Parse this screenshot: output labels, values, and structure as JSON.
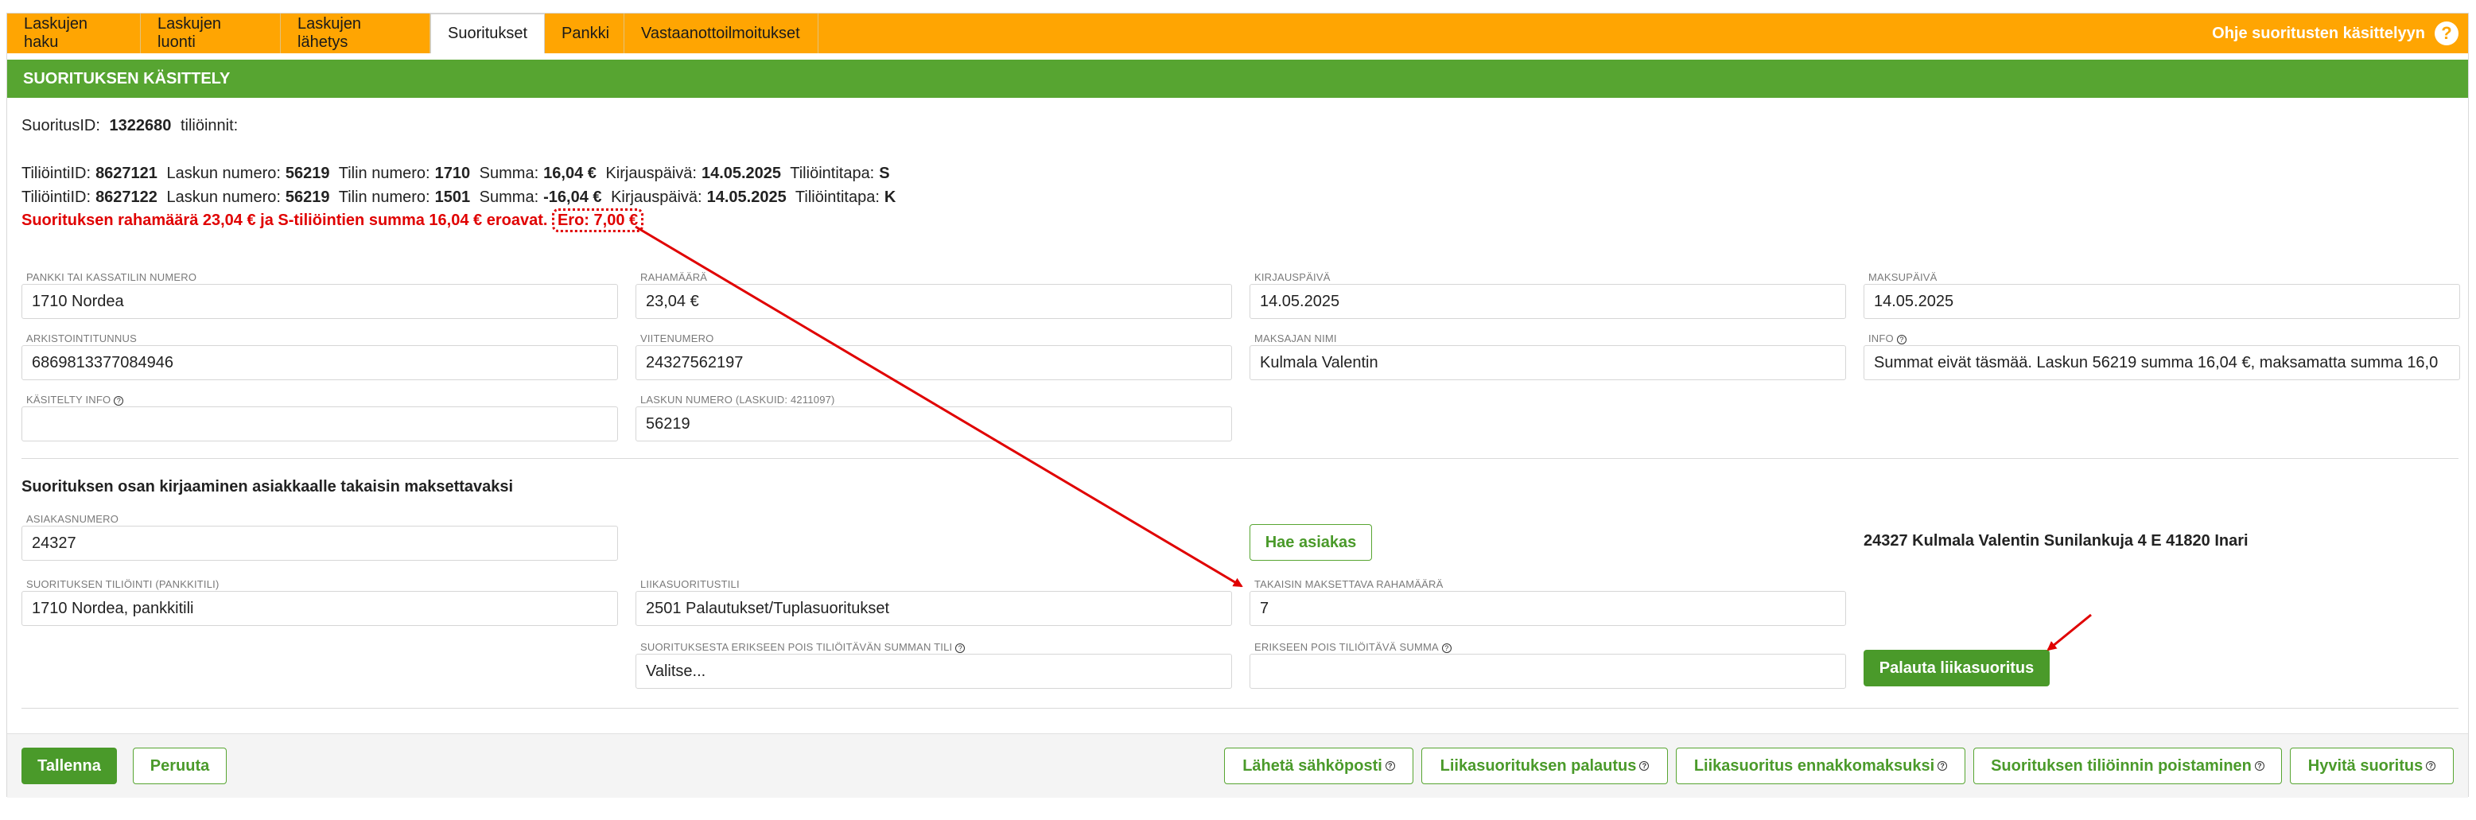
{
  "tabs": [
    {
      "label": "Laskujen haku"
    },
    {
      "label": "Laskujen luonti"
    },
    {
      "label": "Laskujen lähetys"
    },
    {
      "label": "Suoritukset"
    },
    {
      "label": "Pankki"
    },
    {
      "label": "Vastaanottoilmoitukset"
    }
  ],
  "help": {
    "label": "Ohje suoritusten käsittelyyn",
    "icon": "?"
  },
  "section": {
    "title": "SUORITUKSEN KÄSITTELY"
  },
  "summary": {
    "id_label": "SuoritusID:",
    "id_value": "1322680",
    "id_suffix": "tiliöinnit:"
  },
  "postings": [
    {
      "l1": "TiliöintiID:",
      "v1": "8627121",
      "l2": "Laskun numero:",
      "v2": "56219",
      "l3": "Tilin numero:",
      "v3": "1710",
      "l4": "Summa:",
      "v4": "16,04 €",
      "l5": "Kirjauspäivä:",
      "v5": "14.05.2025",
      "l6": "Tiliöintitapa:",
      "v6": "S"
    },
    {
      "l1": "TiliöintiID:",
      "v1": "8627122",
      "l2": "Laskun numero:",
      "v2": "56219",
      "l3": "Tilin numero:",
      "v3": "1501",
      "l4": "Summa:",
      "v4": "-16,04 €",
      "l5": "Kirjauspäivä:",
      "v5": "14.05.2025",
      "l6": "Tiliöintitapa:",
      "v6": "K"
    }
  ],
  "warning": {
    "text": "Suorituksen rahamäärä 23,04 € ja S-tiliöintien summa 16,04 € eroavat.",
    "diff": "Ero: 7,00 €"
  },
  "fields": {
    "bank": {
      "label": "PANKKI TAI KASSATILIN NUMERO",
      "value": "1710 Nordea"
    },
    "amount": {
      "label": "RAHAMÄÄRÄ",
      "value": "23,04 €"
    },
    "booking_date": {
      "label": "KIRJAUSPÄIVÄ",
      "value": "14.05.2025"
    },
    "payment_date": {
      "label": "MAKSUPÄIVÄ",
      "value": "14.05.2025"
    },
    "archive_id": {
      "label": "ARKISTOINTITUNNUS",
      "value": "6869813377084946"
    },
    "reference": {
      "label": "VIITENUMERO",
      "value": "24327562197"
    },
    "payer_name": {
      "label": "MAKSAJAN NIMI",
      "value": "Kulmala Valentin"
    },
    "info": {
      "label": "INFO",
      "value": "Summat eivät täsmää. Laskun 56219 summa 16,04 €, maksamatta summa 16,0"
    },
    "handled_info": {
      "label": "KÄSITELTY INFO",
      "value": ""
    },
    "invoice_number": {
      "label": "LASKUN NUMERO (LASKUID: 4211097)",
      "value": "56219"
    }
  },
  "refund": {
    "title": "Suorituksen osan kirjaaminen asiakkaalle takaisin maksettavaksi",
    "customer_number": {
      "label": "ASIAKASNUMERO",
      "value": "24327"
    },
    "fetch_customer": "Hae asiakas",
    "customer_info": "24327 Kulmala Valentin Sunilankuja 4 E 41820 Inari",
    "payment_account": {
      "label": "SUORITUKSEN TILIÖINTI (PANKKITILI)",
      "value": "1710 Nordea, pankkitili"
    },
    "overpayment_account": {
      "label": "LIIKASUORITUSTILI",
      "value": "2501 Palautukset/Tuplasuoritukset"
    },
    "refund_amount": {
      "label": "TAKAISIN MAKSETTAVA RAHAMÄÄRÄ",
      "value": "7"
    },
    "separate_account": {
      "label": "SUORITUKSESTA ERIKSEEN POIS TILIÖITÄVÄN SUMMAN TILI",
      "value": "Valitse..."
    },
    "separate_amount": {
      "label": "ERIKSEEN POIS TILIÖITÄVÄ SUMMA",
      "value": ""
    },
    "return_button": "Palauta liikasuoritus"
  },
  "footer": {
    "save": "Tallenna",
    "cancel": "Peruuta",
    "send_email": "Lähetä sähköposti",
    "overpayment_return": "Liikasuorituksen palautus",
    "advance_payment": "Liikasuoritus ennakkomaksuksi",
    "remove_posting": "Suorituksen tiliöinnin poistaminen",
    "credit": "Hyvitä suoritus"
  },
  "colors": {
    "tabbar": "#ffa502",
    "header": "#57a531",
    "warning": "#e00000",
    "arrow": "#e00000"
  }
}
